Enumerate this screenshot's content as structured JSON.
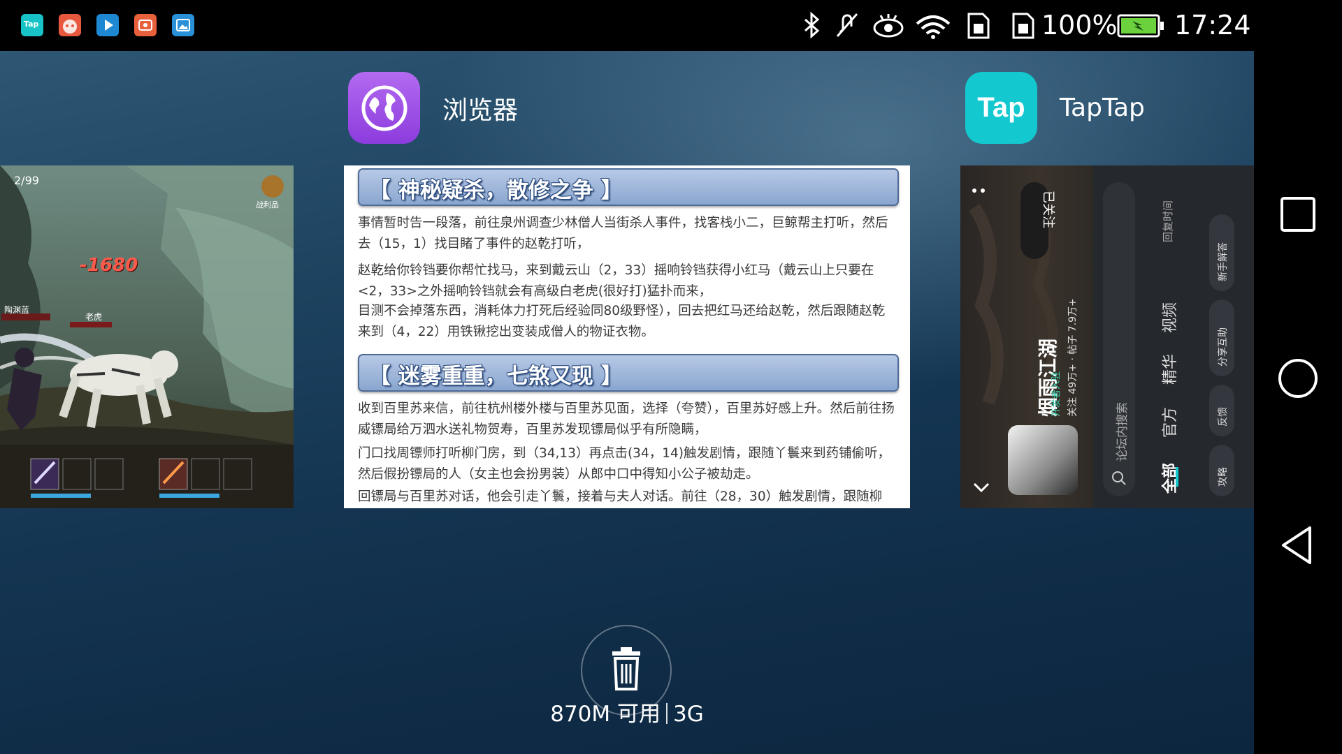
{
  "status_bar": {
    "notification_apps": [
      {
        "name": "taptap-notif-icon",
        "label": "Tap",
        "color": "#17c3c7"
      },
      {
        "name": "game-notif-icon",
        "color": "#e8583f"
      },
      {
        "name": "video-player-notif-icon",
        "color": "#1e88d2"
      },
      {
        "name": "screen-recorder-notif-icon",
        "color": "#e9603c"
      },
      {
        "name": "gallery-notif-icon",
        "color": "#2a90d8"
      }
    ],
    "battery_percent": "100%",
    "time": "17:24",
    "icons": [
      "bluetooth-icon",
      "mute-icon",
      "eye-comfort-icon",
      "wifi-icon",
      "sim1-icon",
      "sim2-icon",
      "battery-charging-icon"
    ]
  },
  "recents": {
    "browser_app": {
      "name": "浏览器",
      "icon": "globe-icon",
      "color": "#a24fe6"
    },
    "taptap_app": {
      "name": "TapTap",
      "icon_label": "Tap",
      "color": "#14c8cf"
    },
    "game_card": {
      "counter": "2/99",
      "loot_label": "战利品",
      "damage": "-1680",
      "enemy_label": "老虎",
      "player_label": "陶渊蓝"
    },
    "doc_card": {
      "section1_title": "【 神秘疑杀，散修之争 】",
      "section1_paragraphs": [
        "事情暂时告一段落，前往泉州调查少林僧人当街杀人事件，找客栈小二，巨鲸帮主打听，然后去（15，1）找目睹了事件的赵乾打听，",
        "赵乾给你铃铛要你帮忙找马，来到戴云山（2，33）摇响铃铛获得小红马（戴云山上只要在<2，33>之外摇响铃铛就会有高级白老虎(很好打)猛扑而来，",
        "目测不会掉落东西，消耗体力打死后经验同80级野怪），回去把红马还给赵乾，然后跟随赵乾来到（4，22）用铁锹挖出变装成僧人的物证衣物。"
      ],
      "section2_title": "【 迷雾重重，七煞又现 】",
      "section2_paragraphs": [
        "收到百里苏来信，前往杭州楼外楼与百里苏见面，选择（夸赞），百里苏好感上升。然后前往扬威镖局给万泗水送礼物贺寿，百里苏发现镖局似乎有所隐瞒，",
        "门口找周镖师打听柳门房，到（34,13）再点击(34，14)触发剧情，跟随丫鬟来到药铺偷听，然后假扮镖局的人（女主也会扮男装）从郎中口中得知小公子被劫走。",
        "回镖局与百里苏对话，他会引走丫鬟，接着与夫人对话。前往（28，30）触发剧情，跟随柳"
      ]
    },
    "taptap_card": {
      "follow_button": "已关注",
      "forum_title": "烟雨江湖",
      "developer_badge": "开发者入驻",
      "stats": "关注 49万+ · 帖子 7.9万+",
      "search_placeholder": "论坛内搜索",
      "tabs": [
        "全部",
        "官方",
        "精华",
        "视频"
      ],
      "sort_label": "回复时间",
      "tags": [
        "新手解答",
        "分享互助",
        "反馈",
        "攻略"
      ]
    },
    "memory": {
      "available": "870M 可用",
      "total": "3G"
    }
  },
  "nav_bar": {
    "buttons": [
      "recents-icon",
      "home-icon",
      "back-icon"
    ]
  }
}
